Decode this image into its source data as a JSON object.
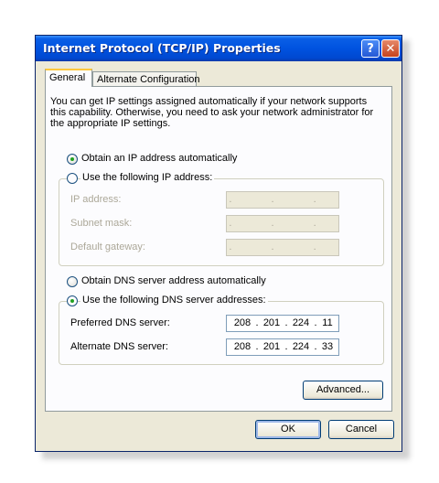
{
  "window": {
    "title": "Internet Protocol (TCP/IP) Properties",
    "help_glyph": "?",
    "close_glyph": "✕"
  },
  "tabs": [
    {
      "label": "General"
    },
    {
      "label": "Alternate Configuration"
    }
  ],
  "intro_text": "You can get IP settings assigned automatically if your network supports this capability. Otherwise, you need to ask your network administrator for the appropriate IP settings.",
  "ip": {
    "auto_label": "Obtain an IP address automatically",
    "manual_label": "Use the following IP address:",
    "selected": "auto",
    "fields": [
      {
        "label": "IP address:",
        "value": ". . ."
      },
      {
        "label": "Subnet mask:",
        "value": ". . ."
      },
      {
        "label": "Default gateway:",
        "value": ". . ."
      }
    ]
  },
  "dns": {
    "auto_label": "Obtain DNS server address automatically",
    "manual_label": "Use the following DNS server addresses:",
    "selected": "manual",
    "preferred": {
      "label": "Preferred DNS server:",
      "octets": [
        "208",
        "201",
        "224",
        "11"
      ]
    },
    "alternate": {
      "label": "Alternate DNS server:",
      "octets": [
        "208",
        "201",
        "224",
        "33"
      ]
    }
  },
  "buttons": {
    "advanced": "Advanced...",
    "ok": "OK",
    "cancel": "Cancel"
  },
  "colors": {
    "title_bar": "#0053e0",
    "radio_dot": "#21a121",
    "window_bg": "#ece9d8"
  }
}
